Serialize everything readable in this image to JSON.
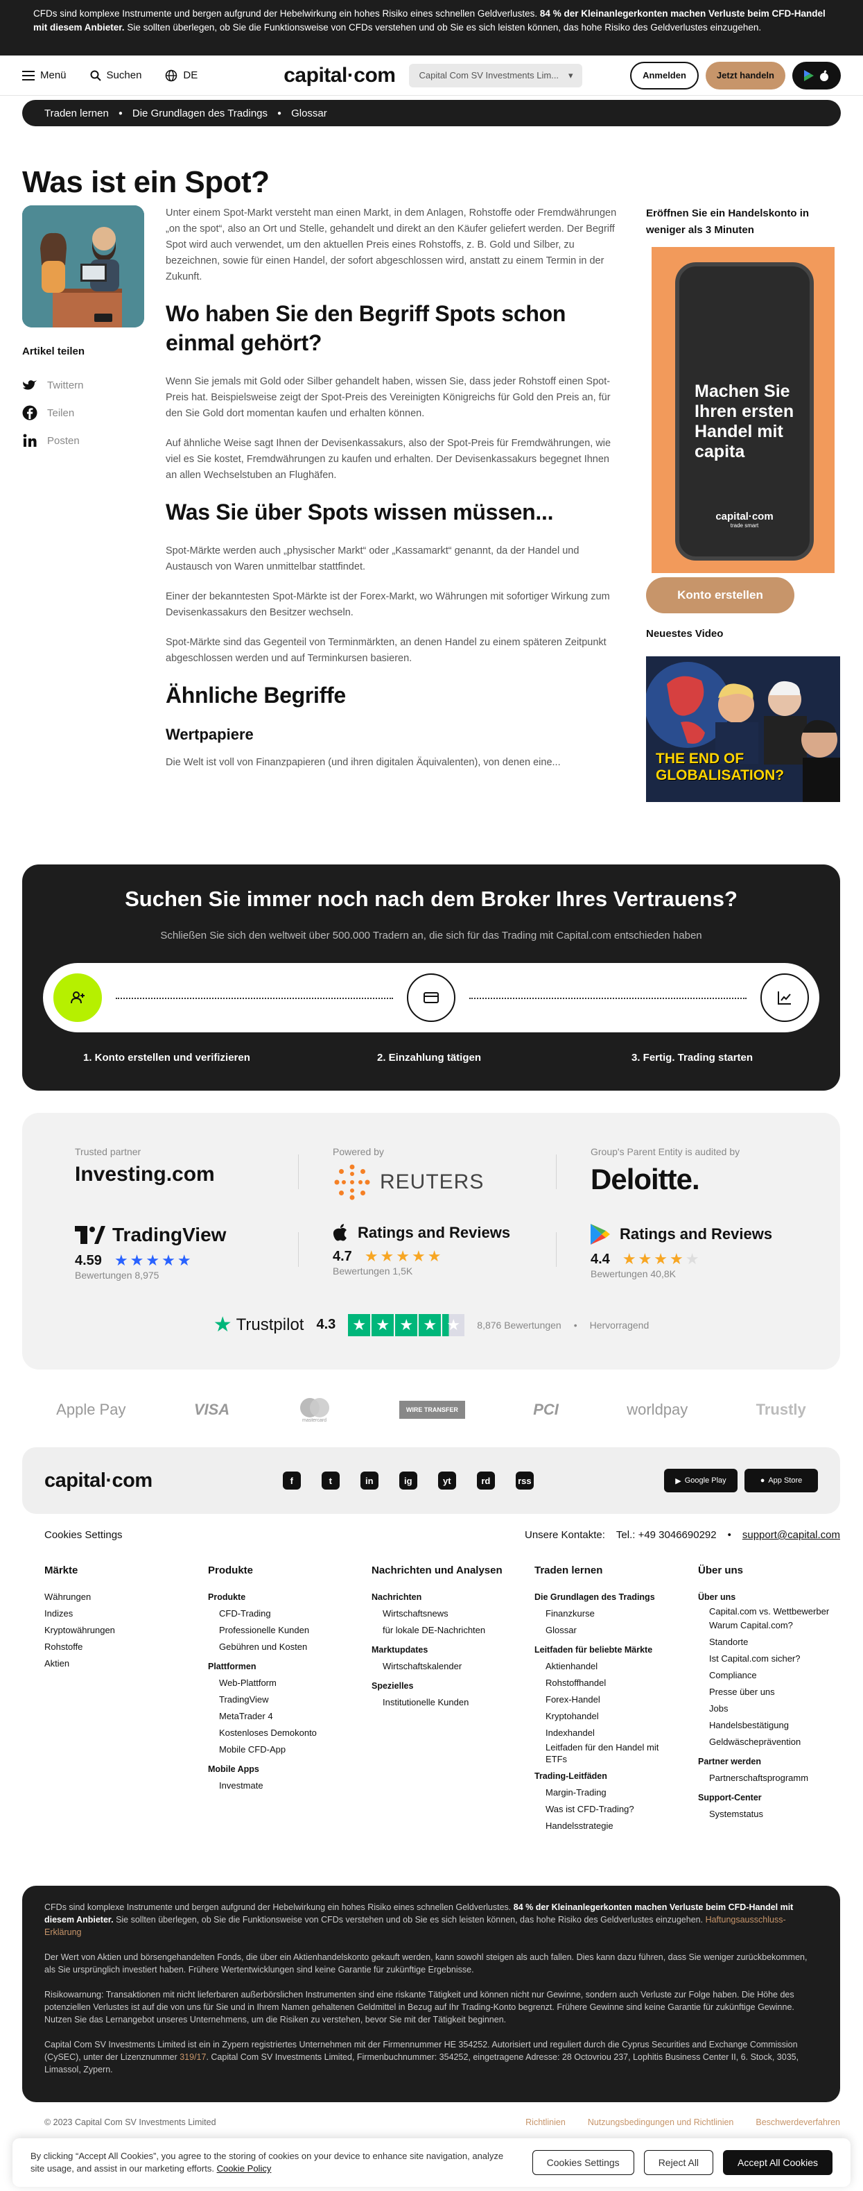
{
  "risk_banner": {
    "text1": "CFDs sind komplexe Instrumente und bergen aufgrund der Hebelwirkung ein hohes Risiko eines schnellen Geldverlustes.",
    "bold": "84 % der Kleinanlegerkonten machen Verluste beim CFD-Handel mit diesem Anbieter.",
    "text2": "Sie sollten überlegen, ob Sie die Funktionsweise von CFDs verstehen und ob Sie es sich leisten können, das hohe Risiko des Geldverlustes einzugehen."
  },
  "header": {
    "menu": "Menü",
    "search": "Suchen",
    "lang": "DE",
    "logo": "capital·com",
    "account": "Capital Com SV Investments Lim...",
    "login": "Anmelden",
    "trade": "Jetzt handeln"
  },
  "breadcrumb": [
    "Traden lernen",
    "Die Grundlagen des Tradings",
    "Glossar"
  ],
  "page_title": "Was ist ein Spot?",
  "share": {
    "title": "Artikel teilen",
    "items": [
      "Twittern",
      "Teilen",
      "Posten"
    ]
  },
  "article": {
    "intro": "Unter einem Spot-Markt versteht man einen Markt, in dem Anlagen, Rohstoffe oder Fremdwährungen „on the spot“, also an Ort und Stelle, gehandelt und direkt an den Käufer geliefert werden. Der Begriff Spot wird auch verwendet, um den aktuellen Preis eines Rohstoffs, z. B. Gold und Silber, zu bezeichnen, sowie für einen Handel, der sofort abgeschlossen wird, anstatt zu einem Termin in der Zukunft.",
    "h2a": "Wo haben Sie den Begriff Spots schon einmal gehört?",
    "p1": "Wenn Sie jemals mit Gold oder Silber gehandelt haben, wissen Sie, dass jeder Rohstoff einen Spot-Preis hat. Beispielsweise zeigt der Spot-Preis des Vereinigten Königreichs für Gold den Preis an, für den Sie Gold dort momentan kaufen und erhalten können.",
    "p2": "Auf ähnliche Weise sagt Ihnen der Devisenkassakurs, also der Spot-Preis für Fremdwährungen, wie viel es Sie kostet, Fremdwährungen zu kaufen und erhalten. Der Devisenkassakurs begegnet Ihnen an allen Wechselstuben an Flughäfen.",
    "h2b": "Was Sie über Spots wissen müssen...",
    "p3": "Spot-Märkte werden auch „physischer Markt“ oder „Kassamarkt“ genannt, da der Handel und Austausch von Waren unmittelbar stattfindet.",
    "p4": "Einer der bekanntesten Spot-Märkte ist der Forex-Markt, wo Währungen mit sofortiger Wirkung zum Devisenkassakurs den Besitzer wechseln.",
    "p5": "Spot-Märkte sind das Gegenteil von Terminmärkten, an denen Handel zu einem späteren Zeitpunkt abgeschlossen werden und auf Terminkursen basieren.",
    "h2c": "Ähnliche Begriffe",
    "h3": "Wertpapiere",
    "p6": "Die Welt ist voll von Finanzpapieren (und ihren digitalen Äquivalenten), von denen eine..."
  },
  "sidebar": {
    "promo_title": "Eröffnen Sie ein Handelskonto in weniger als 3 Minuten",
    "phone_text": "Machen Sie Ihren ersten Handel mit capita",
    "phone_brand": "capital·com",
    "phone_tag": "trade smart",
    "cta": "Konto erstellen",
    "video_title": "Neuestes Video",
    "video_caption": "THE END OF GLOBALISATION?"
  },
  "broker": {
    "title": "Suchen Sie immer noch nach dem Broker Ihres Vertrauens?",
    "subtitle": "Schließen Sie sich den weltweit über 500.000 Tradern an, die sich für das Trading mit Capital.com entschieden haben",
    "steps": [
      "1. Konto erstellen und verifizieren",
      "2. Einzahlung tätigen",
      "3. Fertig. Trading starten"
    ]
  },
  "partners": {
    "cap1": "Trusted partner",
    "name1": "Investing.com",
    "cap2": "Powered by",
    "name2": "REUTERS",
    "cap3": "Group's Parent Entity is audited by",
    "name3": "Deloitte.",
    "r1_name": "TradingView",
    "r1_rating": "4.59",
    "r1_count": "Bewertungen 8,975",
    "r2_name": "Ratings and Reviews",
    "r2_rating": "4.7",
    "r2_count": "Bewertungen 1,5K",
    "r3_name": "Ratings and Reviews",
    "r3_rating": "4.4",
    "r3_count": "Bewertungen 40,8K",
    "tp_name": "Trustpilot",
    "tp_rating": "4.3",
    "tp_count": "8,876 Bewertungen",
    "tp_label": "Hervorragend"
  },
  "payments": [
    "Apple Pay",
    "VISA",
    "mastercard",
    "WIRE TRANSFER",
    "PCI",
    "worldpay",
    "Trustly"
  ],
  "footer": {
    "logo": "capital·com",
    "social": [
      "f",
      "t",
      "in",
      "ig",
      "yt",
      "rd",
      "rss"
    ],
    "google": "Google Play",
    "apple": "App Store",
    "cookies": "Cookies Settings",
    "contacts_label": "Unsere Kontakte:",
    "phone": "Tel.: +49 3046690292",
    "email": "support@capital.com",
    "col1": {
      "title": "Märkte",
      "items": [
        "Währungen",
        "Indizes",
        "Kryptowährungen",
        "Rohstoffe",
        "Aktien"
      ]
    },
    "col2": {
      "title": "Produkte",
      "g1": "Produkte",
      "g1i": [
        "CFD-Trading",
        "Professionelle Kunden",
        "Gebühren und Kosten"
      ],
      "g2": "Plattformen",
      "g2i": [
        "Web-Plattform",
        "TradingView",
        "MetaTrader 4",
        "Kostenloses Demokonto",
        "Mobile CFD-App"
      ],
      "g3": "Mobile Apps",
      "g3i": [
        "Investmate"
      ]
    },
    "col3": {
      "title": "Nachrichten und Analysen",
      "g1": "Nachrichten",
      "g1i": [
        "Wirtschaftsnews",
        "für lokale DE-Nachrichten"
      ],
      "g2": "Marktupdates",
      "g2i": [
        "Wirtschaftskalender"
      ],
      "g3": "Spezielles",
      "g3i": [
        "Institutionelle Kunden"
      ]
    },
    "col4": {
      "title": "Traden lernen",
      "g1": "Die Grundlagen des Tradings",
      "g1i": [
        "Finanzkurse",
        "Glossar"
      ],
      "g2": "Leitfaden für beliebte Märkte",
      "g2i": [
        "Aktienhandel",
        "Rohstoffhandel",
        "Forex-Handel",
        "Kryptohandel",
        "Indexhandel",
        "Leitfaden für den Handel mit ETFs"
      ],
      "g3": "Trading-Leitfäden",
      "g3i": [
        "Margin-Trading",
        "Was ist CFD-Trading?",
        "Handelsstrategie"
      ]
    },
    "col5": {
      "title": "Über uns",
      "g1": "Über uns",
      "g1i": [
        "Capital.com vs. Wettbewerber",
        "Warum Capital.com?",
        "Standorte",
        "Ist Capital.com sicher?",
        "Compliance",
        "Presse über uns",
        "Jobs",
        "Handelsbestätigung",
        "Geldwäscheprävention"
      ],
      "g2": "Partner werden",
      "g2i": [
        "Partnerschaftsprogramm"
      ],
      "g3": "Support-Center",
      "g3i": [
        "Systemstatus"
      ]
    }
  },
  "legal": {
    "p1a": "CFDs sind komplexe Instrumente und bergen aufgrund der Hebelwirkung ein hohes Risiko eines schnellen Geldverlustes.",
    "p1b": "84 % der Kleinanlegerkonten machen Verluste beim CFD-Handel mit diesem Anbieter.",
    "p1c": "Sie sollten überlegen, ob Sie die Funktionsweise von CFDs verstehen und ob Sie es sich leisten können, das hohe Risiko des Geldverlustes einzugehen.",
    "p1link": "Haftungsausschluss-Erklärung",
    "p2": "Der Wert von Aktien und börsengehandelten Fonds, die über ein Aktienhandelskonto gekauft werden, kann sowohl steigen als auch fallen. Dies kann dazu führen, dass Sie weniger zurückbekommen, als Sie ursprünglich investiert haben. Frühere Wertentwicklungen sind keine Garantie für zukünftige Ergebnisse.",
    "p3": "Risikowarnung: Transaktionen mit nicht lieferbaren außerbörslichen Instrumenten sind eine riskante Tätigkeit und können nicht nur Gewinne, sondern auch Verluste zur Folge haben. Die Höhe des potenziellen Verlustes ist auf die von uns für Sie und in Ihrem Namen gehaltenen Geldmittel in Bezug auf Ihr Trading-Konto begrenzt. Frühere Gewinne sind keine Garantie für zukünftige Gewinne. Nutzen Sie das Lernangebot unseres Unternehmens, um die Risiken zu verstehen, bevor Sie mit der Tätigkeit beginnen.",
    "p4a": "Capital Com SV Investments Limited ist ein in Zypern registriertes Unternehmen mit der Firmennummer HE 354252. Autorisiert und reguliert durch die Cyprus Securities and Exchange Commission (CySEC), unter der Lizenznummer",
    "p4link": "319/17",
    "p4b": ". Capital Com SV Investments Limited, Firmenbuchnummer: 354252, eingetragene Adresse: 28 Octovriou 237, Lophitis Business Center II, 6. Stock, 3035, Limassol, Zypern."
  },
  "copyright": "© 2023 Capital Com SV Investments Limited",
  "copy_links": [
    "Richtlinien",
    "Nutzungsbedingungen und Richtlinien",
    "Beschwerdeverfahren"
  ],
  "cookie": {
    "text": "By clicking “Accept All Cookies”, you agree to the storing of cookies on your device to enhance site navigation, analyze site usage, and assist in our marketing efforts.",
    "link": "Cookie Policy",
    "settings": "Cookies Settings",
    "reject": "Reject All",
    "accept": "Accept All Cookies"
  },
  "colors": {
    "dark": "#1d1d1d",
    "tan": "#c7956a",
    "lime": "#b6f000",
    "orange": "#f29a5b",
    "star": "#f7a623",
    "trustpilot": "#00b67a"
  }
}
